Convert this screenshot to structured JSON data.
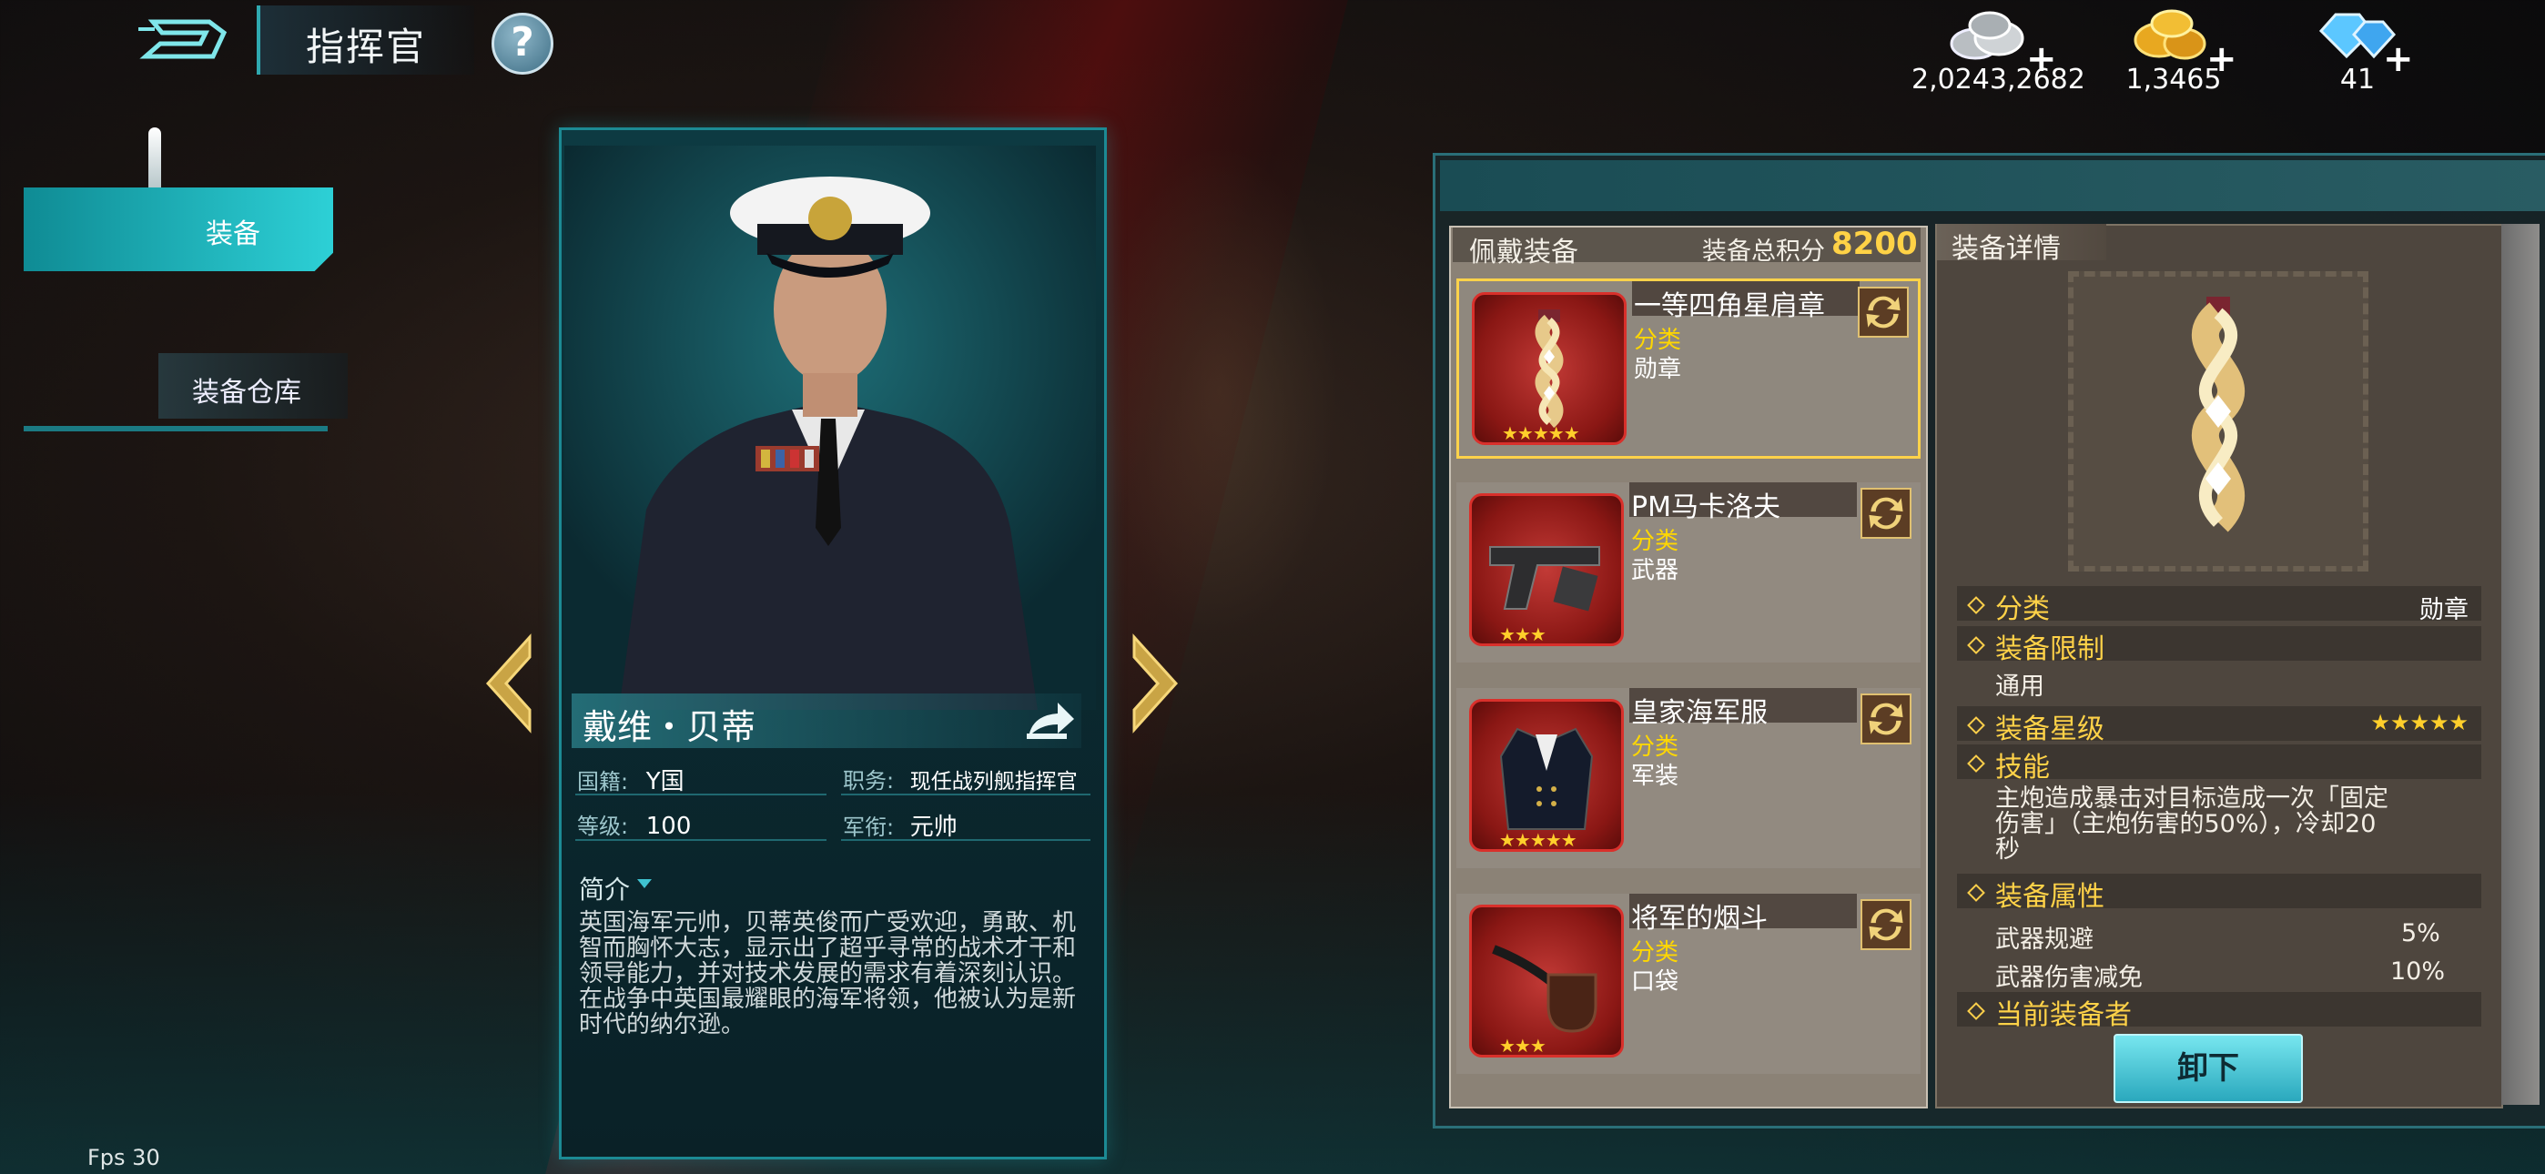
{
  "header": {
    "title": "指挥官",
    "help_symbol": "?"
  },
  "resources": [
    {
      "name": "silver-coins",
      "value": "2,0243,2682",
      "plus": "+"
    },
    {
      "name": "gold-coins",
      "value": "1,3465",
      "plus": "+"
    },
    {
      "name": "diamonds",
      "value": "41",
      "plus": "+"
    }
  ],
  "sidebar": {
    "items": [
      {
        "label": "装备",
        "active": true
      },
      {
        "label": "装备仓库",
        "active": false
      }
    ]
  },
  "commander": {
    "name": "戴维・贝蒂",
    "nationality_label": "国籍:",
    "nationality": "Y国",
    "position_label": "职务:",
    "position": "现任战列舰指挥官",
    "level_label": "等级:",
    "level": "100",
    "rank_label": "军衔:",
    "rank": "元帅",
    "brief_label": "简介",
    "brief": "英国海军元帅，贝蒂英俊而广受欢迎，勇敢、机智而胸怀大志，显示出了超乎寻常的战术才干和领导能力，并对技术发展的需求有着深刻认识。在战争中英国最耀眼的海军将领，他被认为是新时代的纳尔逊。"
  },
  "equipment_list": {
    "title": "佩戴装备",
    "score_label": "装备总积分",
    "score": "8200",
    "items": [
      {
        "name": "一等四角星肩章",
        "category_label": "分类",
        "category": "勋章",
        "stars": "★★★★★",
        "selected": true,
        "icon": "epaulette-icon"
      },
      {
        "name": "PM马卡洛夫",
        "category_label": "分类",
        "category": "武器",
        "stars": "★★★",
        "selected": false,
        "icon": "pistol-icon"
      },
      {
        "name": "皇家海军服",
        "category_label": "分类",
        "category": "军装",
        "stars": "★★★★★",
        "selected": false,
        "icon": "uniform-icon"
      },
      {
        "name": "将军的烟斗",
        "category_label": "分类",
        "category": "口袋",
        "stars": "★★★",
        "selected": false,
        "icon": "pipe-icon"
      }
    ]
  },
  "details": {
    "title": "装备详情",
    "category_label": "分类",
    "category_value": "勋章",
    "restriction_label": "装备限制",
    "restriction_value": "通用",
    "star_label": "装备星级",
    "star_value": "★★★★★",
    "skill_label": "技能",
    "skill_text": "主炮造成暴击对目标造成一次「固定伤害」（主炮伤害的50%），冷却20秒",
    "attr_label": "装备属性",
    "attrs": [
      {
        "name": "武器规避",
        "value": "5%"
      },
      {
        "name": "武器伤害减免",
        "value": "10%"
      }
    ],
    "holder_label": "当前装备者",
    "unequip_label": "卸下"
  },
  "fps": "Fps 30",
  "colors": {
    "accent": "#2dd0d6",
    "gold": "#ffd246",
    "item_red": "#c23a36"
  }
}
